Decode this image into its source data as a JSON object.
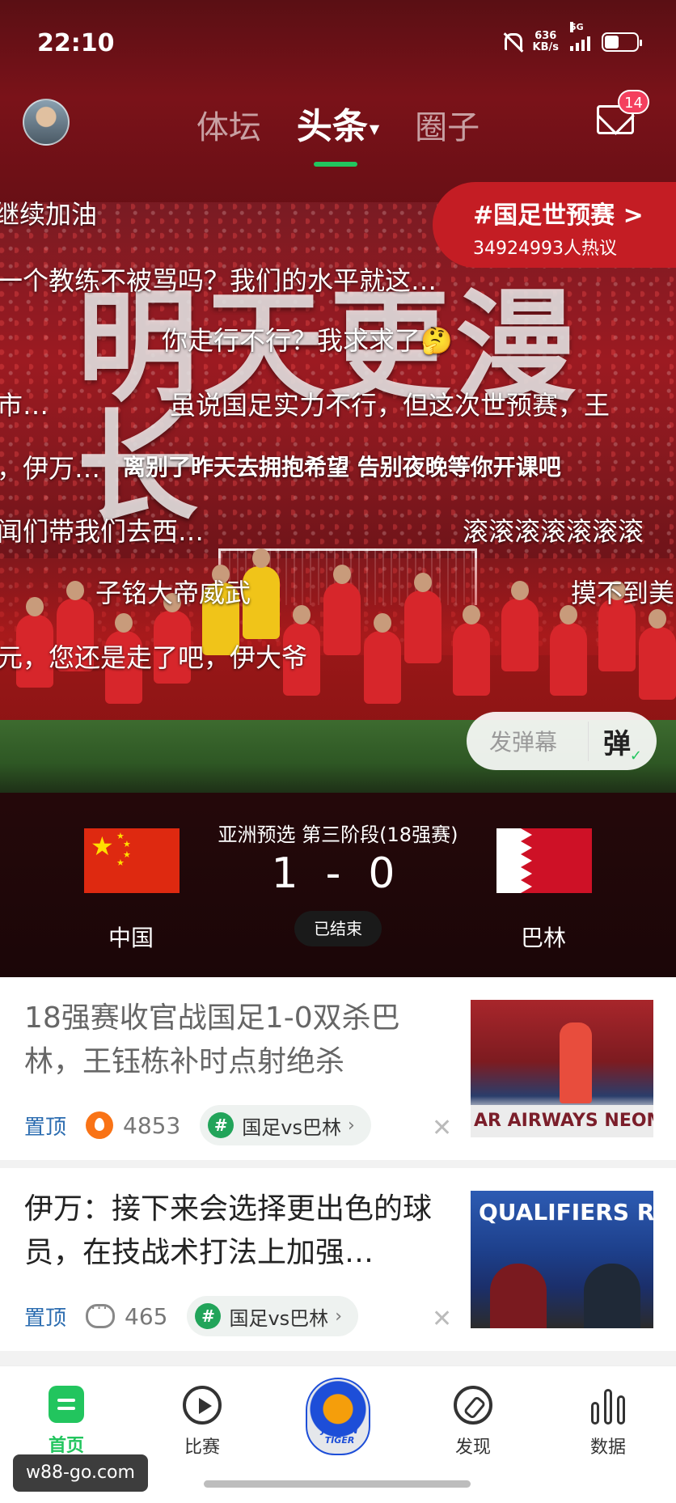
{
  "status_bar": {
    "time": "22:10",
    "net_speed_value": "636",
    "net_speed_unit": "KB/s",
    "network": "5G",
    "icons": [
      "mute-icon",
      "signal-icon",
      "battery-icon"
    ]
  },
  "top_nav": {
    "tabs": [
      {
        "label": "体坛",
        "active": false
      },
      {
        "label": "头条",
        "active": true
      },
      {
        "label": "圈子",
        "active": false
      }
    ],
    "mail_badge": "14"
  },
  "hero": {
    "banner_text": "明天更漫长",
    "topic": {
      "title": "#国足世预赛 >",
      "count": "34924993人热议"
    },
    "danmaku": [
      "继续加油",
      "一个教练不被骂吗？我们的水平就这…",
      "你走行不行？我求求了🤔",
      "市…",
      "虽说国足实力不行，但这次世预赛，王",
      "，伊万…",
      "离别了昨天去拥抱希望 告别夜晚等你开课吧",
      "闻们带我们去西…",
      "滚滚滚滚滚滚滚",
      "子铭大帝威武",
      "摸不到美",
      "元，您还是走了吧，伊大爷"
    ],
    "danmaku_send_label": "发弹幕",
    "danmaku_toggle": "弹"
  },
  "match": {
    "stage": "亚洲预选 第三阶段(18强赛)",
    "home_team": "中国",
    "away_team": "巴林",
    "home_score": "1",
    "score_sep": "-",
    "away_score": "0",
    "status": "已结束"
  },
  "feed": [
    {
      "title": "18强赛收官战国足1-0双杀巴林，王钰栋补时点射绝杀",
      "pin": "置顶",
      "metric_icon": "fire-icon",
      "metric": "4853",
      "tag": "国足vs巴林",
      "thumb_band_text": "AR AIRWAYS NEOM"
    },
    {
      "title": "伊万：接下来会选择更出色的球员，在技战术打法上加强…",
      "pin": "置顶",
      "metric_icon": "comment-icon",
      "metric": "465",
      "tag": "国足vs巴林",
      "thumb_band_text": "QUALIFIERS ROA"
    }
  ],
  "bottom_nav": [
    {
      "label": "首页",
      "icon": "home-icon",
      "active": true
    },
    {
      "label": "比赛",
      "icon": "play-icon",
      "active": false
    },
    {
      "label": "JINMEN TIGER",
      "icon": "club-logo",
      "active": false
    },
    {
      "label": "发现",
      "icon": "discover-icon",
      "active": false
    },
    {
      "label": "数据",
      "icon": "data-icon",
      "active": false
    }
  ],
  "watermark": "w88-go.com",
  "colors": {
    "accent_green": "#22c55e",
    "topic_red": "#c41d24",
    "badge_red": "#f43f5e",
    "pin_blue": "#2b6cb0"
  }
}
